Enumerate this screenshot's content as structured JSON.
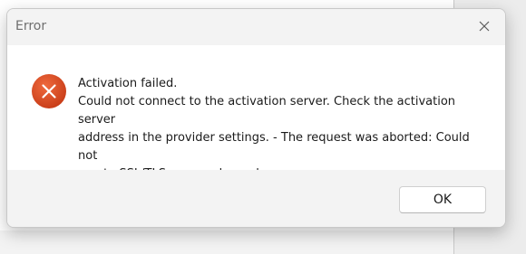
{
  "dialog": {
    "title": "Error",
    "icon": "error-icon",
    "message_lines": [
      "Activation failed.",
      "Could not connect to the activation server. Check the activation server",
      "address in the provider settings. - The request was aborted: Could not",
      "create SSL/TLS secure channel."
    ],
    "ok_label": "OK",
    "close_icon": "close-icon"
  },
  "colors": {
    "error_icon": "#d9441d",
    "title_text": "#6f6f6f",
    "dialog_bg": "#f3f3f3",
    "content_bg": "#ffffff"
  }
}
